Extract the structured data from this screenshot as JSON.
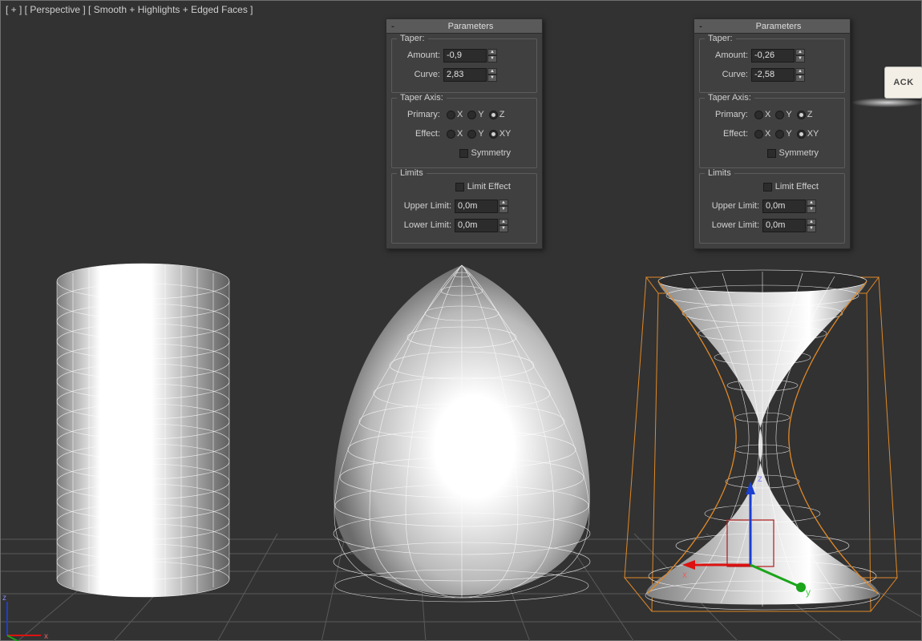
{
  "viewport_label": "[ + ] [ Perspective ] [ Smooth + Highlights + Edged Faces ]",
  "back_badge": "ACK",
  "panel1": {
    "title": "Parameters",
    "taper_title": "Taper:",
    "amount_label": "Amount:",
    "amount_value": "-0,9",
    "curve_label": "Curve:",
    "curve_value": "2,83",
    "axis_title": "Taper Axis:",
    "primary_label": "Primary:",
    "effect_label": "Effect:",
    "axes": {
      "X": "X",
      "Y": "Y",
      "Z": "Z",
      "XY": "XY"
    },
    "primary_selected": "Z",
    "effect_selected": "XY",
    "symmetry_label": "Symmetry",
    "limits_title": "Limits",
    "limit_effect_label": "Limit Effect",
    "upper_label": "Upper Limit:",
    "upper_value": "0,0m",
    "lower_label": "Lower Limit:",
    "lower_value": "0,0m"
  },
  "panel2": {
    "title": "Parameters",
    "taper_title": "Taper:",
    "amount_label": "Amount:",
    "amount_value": "-0,26",
    "curve_label": "Curve:",
    "curve_value": "-2,58",
    "axis_title": "Taper Axis:",
    "primary_label": "Primary:",
    "effect_label": "Effect:",
    "axes": {
      "X": "X",
      "Y": "Y",
      "Z": "Z",
      "XY": "XY"
    },
    "primary_selected": "Z",
    "effect_selected": "XY",
    "symmetry_label": "Symmetry",
    "limits_title": "Limits",
    "limit_effect_label": "Limit Effect",
    "upper_label": "Upper Limit:",
    "upper_value": "0,0m",
    "lower_label": "Lower Limit:",
    "lower_value": "0,0m"
  },
  "gizmo_labels": {
    "x": "x",
    "y": "y",
    "z": "z"
  }
}
